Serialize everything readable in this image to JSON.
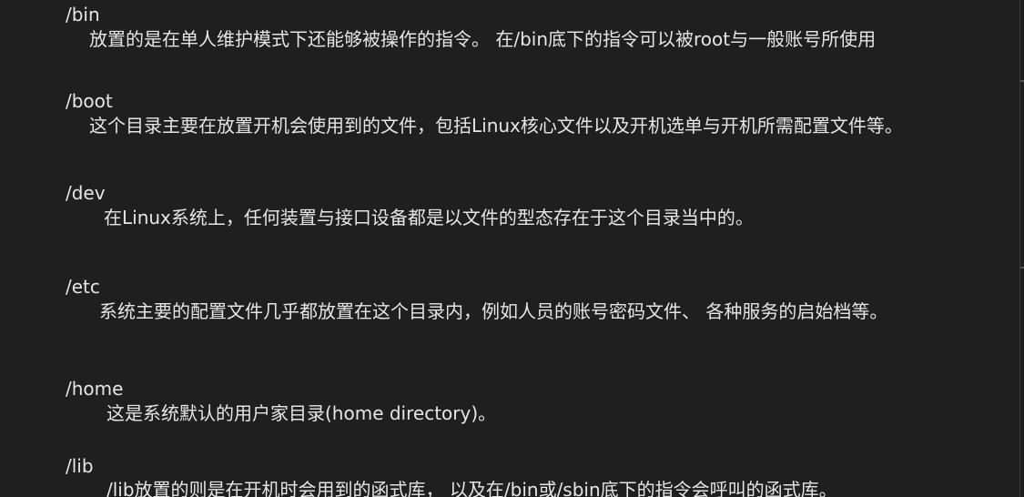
{
  "entries": [
    {
      "path": "/bin",
      "desc": "放置的是在单人维护模式下还能够被操作的指令。 在/bin底下的指令可以被root与一般账号所使用"
    },
    {
      "path": "/boot",
      "desc": "这个目录主要在放置开机会使用到的文件，包括Linux核心文件以及开机选单与开机所需配置文件等。"
    },
    {
      "path": "/dev",
      "desc": "在Linux系统上，任何装置与接口设备都是以文件的型态存在于这个目录当中的。"
    },
    {
      "path": "/etc",
      "desc": "系统主要的配置文件几乎都放置在这个目录内，例如人员的账号密码文件、 各种服务的启始档等。"
    },
    {
      "path": "/home",
      "desc": "这是系统默认的用户家目录(home directory)。"
    },
    {
      "path": "/lib",
      "desc": "/lib放置的则是在开机时会用到的函式库， 以及在/bin或/sbin底下的指令会呼叫的函式库。"
    }
  ]
}
